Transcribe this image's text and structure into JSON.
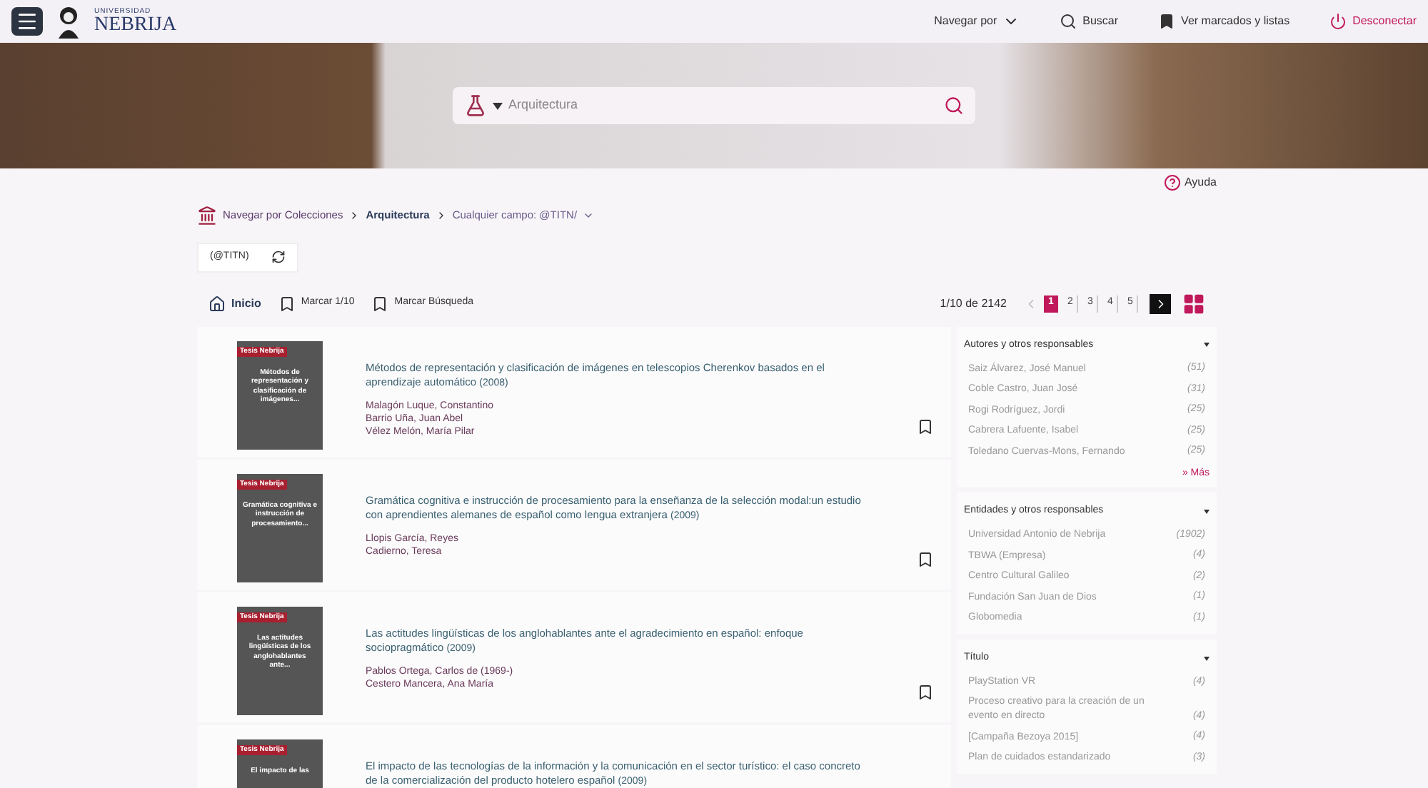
{
  "header": {
    "logo_small": "UNIVERSIDAD",
    "logo": "NEBRIJA",
    "nav": [
      {
        "kind": "dropdown",
        "label": "Navegar por"
      },
      {
        "kind": "search",
        "label": "Buscar"
      },
      {
        "kind": "bookmark",
        "label": "Ver marcados y listas"
      },
      {
        "kind": "power",
        "label": "Desconectar"
      }
    ]
  },
  "search": {
    "placeholder": "Arquitectura"
  },
  "help": "Ayuda",
  "breadcrumb": [
    {
      "label": "Navegar por Colecciones",
      "kind": "link"
    },
    {
      "label": "Arquitectura",
      "kind": "current"
    },
    {
      "label": "Cualquier campo: @TITN/",
      "kind": "dropdown"
    }
  ],
  "query_chip": "(@TITN)",
  "toolbar": {
    "home": "Inicio",
    "mark_page": "Marcar 1/10",
    "mark_search": "Marcar Búsqueda",
    "range": "1/10 de 2142",
    "pages": [
      {
        "label": "1",
        "selected": true
      },
      {
        "label": "2",
        "selected": false
      },
      {
        "label": "3",
        "selected": false
      },
      {
        "label": "4",
        "selected": false
      },
      {
        "label": "5",
        "selected": false
      }
    ]
  },
  "results": [
    {
      "cover_label": "Tesis Nebrija",
      "cover_text": "Métodos de representación y clasificación de imágenes...",
      "title": "Métodos de representación y clasificación de imágenes en telescopios Cherenkov basados en el aprendizaje automático",
      "year": "(2008)",
      "authors": [
        "Malagón Luque, Constantino",
        "Barrio Uña, Juan Abel",
        "Vélez Melón, María Pilar"
      ]
    },
    {
      "cover_label": "Tesis Nebrija",
      "cover_text": "Gramática cognitiva e instrucción de procesamiento...",
      "title": "Gramática cognitiva e instrucción de procesamiento para la enseñanza de la selección modal:un estudio con aprendientes alemanes de español como lengua extranjera",
      "year": "(2009)",
      "authors": [
        "Llopis García, Reyes",
        "Cadierno, Teresa"
      ]
    },
    {
      "cover_label": "Tesis Nebrija",
      "cover_text": "Las actitudes lingüísticas de los anglohablantes ante...",
      "title": "Las actitudes lingüísticas de los anglohablantes ante el agradecimiento en español: enfoque sociopragmático",
      "year": "(2009)",
      "authors": [
        "Pablos Ortega, Carlos de (1969-)",
        "Cestero Mancera, Ana María"
      ]
    },
    {
      "cover_label": "Tesis Nebrija",
      "cover_text": "El impacto de las",
      "title": "El impacto de las tecnologías de la información y la comunicación en el sector turístico: el caso concreto de la comercialización del producto hotelero español",
      "year": "(2009)"
    }
  ],
  "facets": [
    {
      "title": "Autores y otros responsables",
      "items": [
        {
          "label": "Saiz Álvarez, José Manuel",
          "count": "(51)"
        },
        {
          "label": "Coble Castro, Juan José",
          "count": "(31)"
        },
        {
          "label": "Rogi Rodríguez, Jordi",
          "count": "(25)"
        },
        {
          "label": "Cabrera Lafuente, Isabel",
          "count": "(25)"
        },
        {
          "label": "Toledano Cuervas-Mons, Fernando",
          "count": "(25)"
        }
      ],
      "more": "» Más"
    },
    {
      "title": "Entidades y otros responsables",
      "items": [
        {
          "label": "Universidad Antonio de Nebrija",
          "count": "(1902)"
        },
        {
          "label": "TBWA (Empresa)",
          "count": "(4)"
        },
        {
          "label": "Centro Cultural Galileo",
          "count": "(2)"
        },
        {
          "label": "Fundación San Juan de Dios",
          "count": "(1)"
        },
        {
          "label": "Globomedia",
          "count": "(1)"
        }
      ]
    },
    {
      "title": "Título",
      "items": [
        {
          "label": "PlayStation VR",
          "count": "(4)"
        },
        {
          "label": "Proceso creativo para la creación de un evento en directo",
          "count": "(4)"
        },
        {
          "label": "[Campaña Bezoya 2015]",
          "count": "(4)"
        },
        {
          "label": "Plan de cuidados estandarizado",
          "count": "(3)"
        }
      ]
    }
  ]
}
